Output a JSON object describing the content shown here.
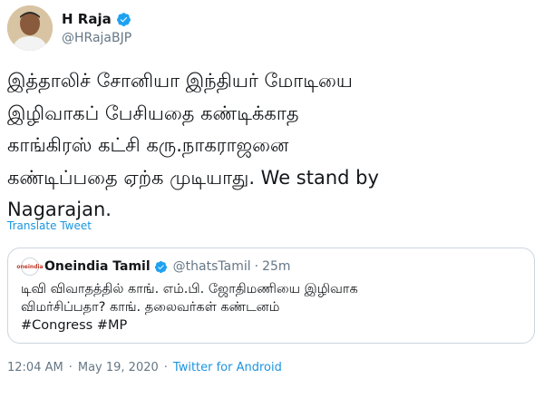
{
  "author": {
    "name": "H Raja",
    "handle": "@HRajaBJP"
  },
  "tweet": {
    "text": "இத்தாலிச் சோனியா இந்தியர் மோடியை\nஇழிவாகப் பேசியதை கண்டிக்காத\nகாங்கிரஸ் கட்சி கரு.நாகராஜனை\nகண்டிப்பதை ஏற்க முடியாது. We stand by\nNagarajan.",
    "translate_label": "Translate Tweet"
  },
  "quoted": {
    "logo_text": "oneindia",
    "name": "Oneindia Tamil",
    "handle": "@thatsTamil",
    "separator": "·",
    "time": "25m",
    "text": "டிவி விவாதத்தில் காங். எம்.பி. ஜோதிமணியை இழிவாக\nவிமர்சிப்பதா? காங். தலைவர்கள் கண்டனம்\n#Congress #MP"
  },
  "meta": {
    "time": "12:04 AM",
    "separator": "·",
    "date": "May 19, 2020",
    "source": "Twitter for Android"
  },
  "colors": {
    "accent": "#1da1f2",
    "secondary_text": "#657786",
    "border": "#ccd6dd"
  }
}
